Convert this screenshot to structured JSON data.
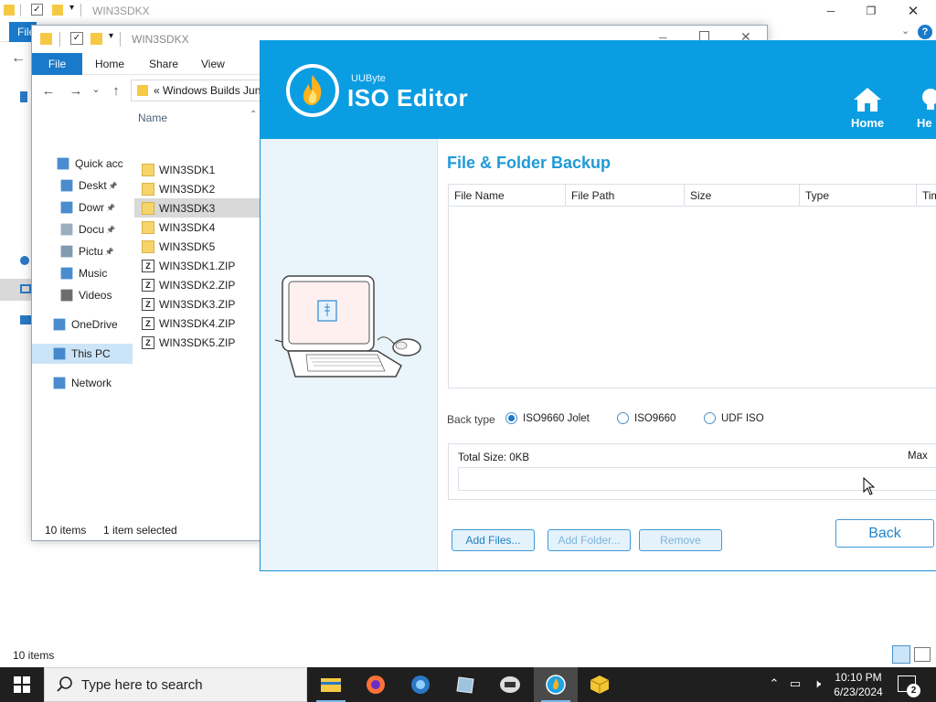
{
  "back_window": {
    "title": "WIN3SDKX",
    "file_tab": "File",
    "status": "10 items"
  },
  "front_window": {
    "title": "WIN3SDKX",
    "ribbon_tabs": [
      "File",
      "Home",
      "Share",
      "View"
    ],
    "address": "«  Windows Builds Jun",
    "nav_items": [
      {
        "label": "Quick acc",
        "icon": "star-icon"
      },
      {
        "label": "Deskt",
        "icon": "desktop-icon",
        "pinned": true
      },
      {
        "label": "Dowr",
        "icon": "download-icon",
        "pinned": true
      },
      {
        "label": "Docu",
        "icon": "document-icon",
        "pinned": true
      },
      {
        "label": "Pictu",
        "icon": "pictures-icon",
        "pinned": true
      },
      {
        "label": "Music",
        "icon": "music-icon"
      },
      {
        "label": "Videos",
        "icon": "videos-icon"
      },
      {
        "label": "OneDrive",
        "icon": "cloud-icon"
      },
      {
        "label": "This PC",
        "icon": "computer-icon",
        "selected": true
      },
      {
        "label": "Network",
        "icon": "network-icon"
      }
    ],
    "column_name": "Name",
    "files": [
      {
        "name": "WIN3SDK1",
        "type": "folder"
      },
      {
        "name": "WIN3SDK2",
        "type": "folder"
      },
      {
        "name": "WIN3SDK3",
        "type": "folder",
        "selected": true
      },
      {
        "name": "WIN3SDK4",
        "type": "folder"
      },
      {
        "name": "WIN3SDK5",
        "type": "folder"
      },
      {
        "name": "WIN3SDK1.ZIP",
        "type": "zip"
      },
      {
        "name": "WIN3SDK2.ZIP",
        "type": "zip"
      },
      {
        "name": "WIN3SDK3.ZIP",
        "type": "zip"
      },
      {
        "name": "WIN3SDK4.ZIP",
        "type": "zip"
      },
      {
        "name": "WIN3SDK5.ZIP",
        "type": "zip"
      }
    ],
    "status_items": "10 items",
    "status_selected": "1 item selected"
  },
  "iso_editor": {
    "brand": "UUByte",
    "title": "ISO Editor",
    "home_label": "Home",
    "help_label": "He",
    "heading": "File & Folder Backup",
    "table_columns": [
      "File Name",
      "File Path",
      "Size",
      "Type",
      "Tim"
    ],
    "back_type_label": "Back type",
    "back_type_options": [
      {
        "label": "ISO9660 Jolet",
        "checked": true
      },
      {
        "label": "ISO9660",
        "checked": false
      },
      {
        "label": "UDF ISO",
        "checked": false
      }
    ],
    "total_size": "Total Size: 0KB",
    "max_label": "Max",
    "buttons": {
      "add_files": "Add Files...",
      "add_folder": "Add Folder...",
      "remove": "Remove",
      "back": "Back"
    }
  },
  "taskbar": {
    "search_placeholder": "Type here to search",
    "time": "10:10 PM",
    "date": "6/23/2024",
    "notification_count": "2"
  },
  "colors": {
    "accent": "#0b9de2",
    "ribbon_file": "#1979ca",
    "heading": "#1f9ad6"
  }
}
